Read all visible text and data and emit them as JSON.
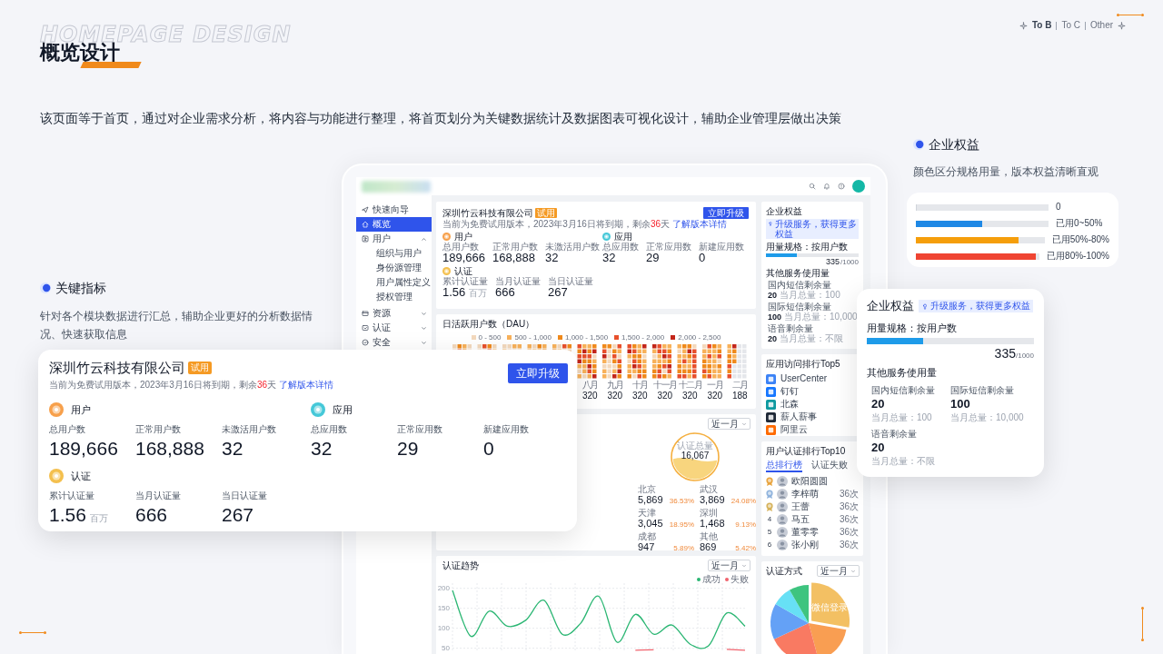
{
  "header": {
    "watermark": "HOMEPAGE DESIGN",
    "title": "概览设计",
    "nav": [
      {
        "label": "To B",
        "selected": true
      },
      {
        "label": "To C",
        "selected": false
      },
      {
        "label": "Other",
        "selected": false
      }
    ]
  },
  "intro": "该页面等于首页，通过对企业需求分析，将内容与功能进行整理，将首页划分为关键数据统计及数据图表可视化设计，辅助企业管理层做出决策",
  "key_metrics": {
    "title": "关键指标",
    "text": "针对各个模块数据进行汇总，辅助企业更好的分析数据情况、快速获取信息"
  },
  "entitlement_intro": {
    "title": "企业权益",
    "text": "颜色区分规格用量，版本权益清晰直观"
  },
  "usage_legend": [
    {
      "level": 0,
      "label": "0"
    },
    {
      "level": 0.5,
      "color": "#1e88e5",
      "label": "已用0~50%"
    },
    {
      "level": 0.8,
      "color": "#f59e0b",
      "label": "已用50%-80%"
    },
    {
      "level": 0.97,
      "color": "#ef4432",
      "label": "已用80%-100%"
    }
  ],
  "console": {
    "sidebar": [
      {
        "label": "快速向导",
        "selected": false
      },
      {
        "label": "概览",
        "selected": true
      },
      {
        "label": "用户",
        "selected": false,
        "expanded": true,
        "children": [
          {
            "label": "组织与用户",
            "selected": false
          },
          {
            "label": "身份源管理",
            "selected": false
          },
          {
            "label": "用户属性定义",
            "selected": false
          },
          {
            "label": "授权管理",
            "selected": false
          }
        ]
      },
      {
        "label": "资源",
        "selected": false,
        "expanded": false
      },
      {
        "label": "认证",
        "selected": false,
        "expanded": false
      },
      {
        "label": "安全",
        "selected": false,
        "expanded": false
      }
    ],
    "company_card": {
      "company": "深圳竹云科技有限公司",
      "badge": "试用",
      "notice": "当前为免费试用版本，2023年3月16日将到期，剩余",
      "days": "36",
      "days_unit": "天",
      "link": "了解版本详情",
      "button": "立即升级",
      "groups": [
        {
          "title": "用户",
          "color": "#f7a04b",
          "stats": [
            {
              "label": "总用户数",
              "value": "189,666"
            },
            {
              "label": "正常用户数",
              "value": "168,888"
            },
            {
              "label": "未激活用户数",
              "value": "32"
            }
          ]
        },
        {
          "title": "应用",
          "color": "#45c8d8",
          "stats": [
            {
              "label": "总应用数",
              "value": "32"
            },
            {
              "label": "正常应用数",
              "value": "29"
            },
            {
              "label": "新建应用数",
              "value": "0"
            }
          ]
        },
        {
          "title": "认证",
          "color": "#f4c04e",
          "stats": [
            {
              "label": "累计认证量",
              "value": "1.56",
              "unit": "百万"
            },
            {
              "label": "当月认证量",
              "value": "666"
            },
            {
              "label": "当日认证量",
              "value": "267"
            }
          ]
        }
      ]
    },
    "dau": {
      "title": "日活跃用户数（DAU）",
      "legend": [
        {
          "label": "0 - 500",
          "color": "#f3d9bd"
        },
        {
          "label": "500 - 1,000",
          "color": "#f8b15a"
        },
        {
          "label": "1,000 - 1,500",
          "color": "#f08a1c"
        },
        {
          "label": "1,500 - 2,000",
          "color": "#e8502c"
        },
        {
          "label": "2,000 - 2,500",
          "color": "#c3261a"
        }
      ],
      "months": [
        {
          "label": "八月",
          "value": "320"
        },
        {
          "label": "九月",
          "value": "320"
        },
        {
          "label": "十月",
          "value": "320"
        },
        {
          "label": "十一月",
          "value": "320"
        },
        {
          "label": "十二月",
          "value": "320"
        },
        {
          "label": "一月",
          "value": "320"
        },
        {
          "label": "二月",
          "value": "188"
        }
      ]
    },
    "region": {
      "range": "近一月",
      "total_label": "认证总量",
      "total": "16,067",
      "cities": [
        {
          "name": "北京",
          "value": "5,869",
          "share": "36.53%"
        },
        {
          "name": "武汉",
          "value": "3,869",
          "share": "24.08%"
        },
        {
          "name": "天津",
          "value": "3,045",
          "share": "18.95%"
        },
        {
          "name": "深圳",
          "value": "1,468",
          "share": "9.13%"
        },
        {
          "name": "成都",
          "value": "947",
          "share": "5.89%"
        },
        {
          "name": "其他",
          "value": "869",
          "share": "5.42%"
        }
      ]
    },
    "trend": {
      "title": "认证趋势",
      "range": "近一月",
      "chart_data": {
        "type": "line",
        "grid": true,
        "ylim": [
          40,
          213
        ],
        "yticks": [
          50,
          100,
          150,
          200
        ],
        "series": [
          {
            "name": "成功",
            "color": "#2bb673",
            "values": [
              195,
              80,
              143,
              105,
              120,
              170,
              85,
              112,
              180,
              65,
              135,
              85,
              108,
              60,
              56,
              138,
              105
            ]
          },
          {
            "name": "失败",
            "color": "#f0646e",
            "values": [
              null,
              null,
              null,
              null,
              null,
              null,
              null,
              null,
              null,
              null,
              45,
              46,
              null,
              null,
              null,
              47,
              45
            ]
          }
        ]
      }
    },
    "entitlement": {
      "title": "企业权益",
      "badge": "升级服务，获得更多权益",
      "spec": "用量规格：按用户数",
      "level": 0.335,
      "used": "335",
      "total": "/1000",
      "other_title": "其他服务使用量",
      "services": [
        {
          "label": "国内短信剩余量",
          "value": "20",
          "total": "当月总量：100"
        },
        {
          "label": "国际短信剩余量",
          "value": "100",
          "total": "当月总量：10,000"
        },
        {
          "label": "语音剩余量",
          "value": "20",
          "total": "当月总量：不限"
        }
      ]
    },
    "top_apps": {
      "title": "应用访问排行Top5",
      "apps": [
        {
          "name": "UserCenter",
          "color": "#3b82f6"
        },
        {
          "name": "钉钉",
          "color": "#1677ff"
        },
        {
          "name": "北森",
          "color": "#0e9aa0"
        },
        {
          "name": "薪人薪事",
          "color": "#1f2937"
        },
        {
          "name": "阿里云",
          "color": "#ff6a00"
        }
      ]
    },
    "user_ranking": {
      "title": "用户认证排行Top10",
      "tabs": [
        {
          "label": "总排行榜",
          "selected": true
        },
        {
          "label": "认证失败",
          "selected": false
        }
      ],
      "rows": [
        {
          "kind": "medal",
          "color": "#e8a33c",
          "name": "欧阳圆圆"
        },
        {
          "kind": "medal",
          "color": "#8fb3dd",
          "name": "李梓萌",
          "count": "36次"
        },
        {
          "kind": "medal",
          "color": "#d6b25a",
          "name": "王蕾",
          "count": "36次"
        },
        {
          "kind": "number",
          "rank": "4",
          "name": "马五",
          "count": "36次"
        },
        {
          "kind": "number",
          "rank": "5",
          "name": "董零零",
          "count": "36次"
        },
        {
          "kind": "number",
          "rank": "6",
          "name": "张小刚",
          "count": "36次"
        }
      ]
    },
    "auth_methods": {
      "title": "认证方式",
      "range": "近一月",
      "slice_label": "微信登录"
    }
  },
  "overview_card": {
    "company": "深圳竹云科技有限公司",
    "badge": "试用",
    "notice": "当前为免费试用版本，2023年3月16日将到期，剩余",
    "days": "36",
    "days_unit": "天",
    "link": "了解版本详情",
    "button": "立即升级",
    "groups": [
      {
        "title": "用户",
        "color": "#f7a04b",
        "stats": [
          {
            "label": "总用户数",
            "value": "189,666"
          },
          {
            "label": "正常用户数",
            "value": "168,888"
          },
          {
            "label": "未激活用户数",
            "value": "32"
          }
        ]
      },
      {
        "title": "应用",
        "color": "#45c8d8",
        "stats": [
          {
            "label": "总应用数",
            "value": "32"
          },
          {
            "label": "正常应用数",
            "value": "29"
          },
          {
            "label": "新建应用数",
            "value": "0"
          }
        ]
      },
      {
        "title": "认证",
        "color": "#f4c04e",
        "stats": [
          {
            "label": "累计认证量",
            "value": "1.56",
            "unit": "百万"
          },
          {
            "label": "当月认证量",
            "value": "666"
          },
          {
            "label": "当日认证量",
            "value": "267"
          }
        ]
      }
    ]
  },
  "entitlement_card": {
    "title": "企业权益",
    "badge": "升级服务，获得更多权益",
    "spec": "用量规格：按用户数",
    "level": 0.335,
    "used": "335",
    "total": "/1000",
    "other_title": "其他服务使用量",
    "services": [
      {
        "label": "国内短信剩余量",
        "value": "20",
        "total": "当月总量：100"
      },
      {
        "label": "国际短信剩余量",
        "value": "100",
        "total": "当月总量：10,000"
      },
      {
        "label": "语音剩余量",
        "value": "20",
        "total": "当月总量：不限"
      }
    ]
  }
}
